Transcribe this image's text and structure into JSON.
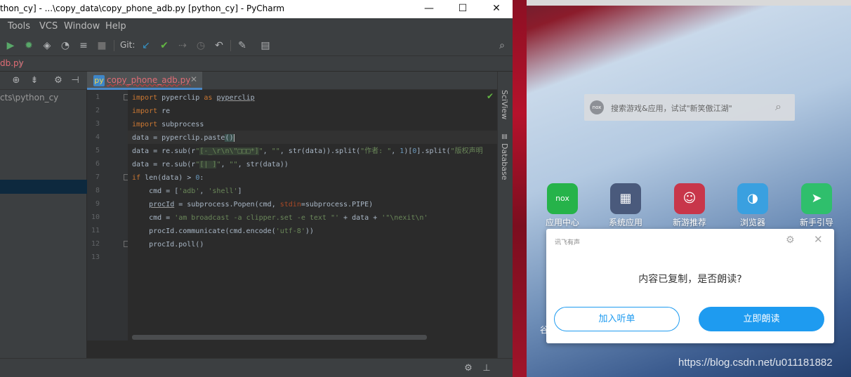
{
  "pycharm": {
    "title": "thon_cy] - ...\\copy_data\\copy_phone_adb.py [python_cy] - PyCharm",
    "window_controls": {
      "minimize": "—",
      "maximize": "☐",
      "close": "✕"
    },
    "menu": [
      "Tools",
      "VCS",
      "Window",
      "Help"
    ],
    "toolbar": {
      "git_label": "Git:"
    },
    "breadcrumb": "db.py",
    "project_panel": {
      "root_label": "cts\\python_cy"
    },
    "editor_tab": {
      "label": "copy_phone_adb.py",
      "close": "✕"
    },
    "side_tabs": [
      "SciView",
      "Database"
    ],
    "line_numbers": [
      "1",
      "2",
      "3",
      "4",
      "5",
      "6",
      "7",
      "8",
      "9",
      "10",
      "11",
      "12",
      "13"
    ],
    "code_lines": [
      "import pyperclip as pyperclip",
      "import re",
      "import subprocess",
      "data = pyperclip.paste()",
      "data = re.sub(r\"[-_\\r\\n\\\"□□□*]\", \"\", str(data)).split(\"作者: \", 1)[0].split(\"版权声明",
      "data = re.sub(r\"[| ]\", \"\", str(data))",
      "if len(data) > 0:",
      "    cmd = ['adb', 'shell']",
      "    procId = subprocess.Popen(cmd, stdin=subprocess.PIPE)",
      "    cmd = 'am broadcast -a clipper.set -e text \"' + data + '\"\\nexit\\n'",
      "    procId.communicate(cmd.encode('utf-8'))",
      "    procId.poll()",
      ""
    ]
  },
  "emulator": {
    "search_logo": "nox",
    "search_placeholder": "搜索游戏&应用，试试\"新笑傲江湖\"",
    "apps": [
      {
        "label": "应用中心",
        "color": "#26b34a",
        "glyph": "nox"
      },
      {
        "label": "系统应用",
        "color": "#4a5a7c",
        "glyph": "▦"
      },
      {
        "label": "新游推荐",
        "color": "#c8364a",
        "glyph": "☺"
      },
      {
        "label": "浏览器",
        "color": "#3aa0e0",
        "glyph": "◑"
      },
      {
        "label": "新手引导",
        "color": "#2fbf6c",
        "glyph": "➤"
      }
    ],
    "partial_label": "谷",
    "dialog": {
      "app_name": "讯飞有声",
      "message": "内容已复制，是否朗读?",
      "secondary_button": "加入听单",
      "primary_button": "立即朗读"
    }
  },
  "watermark": "https://blog.csdn.net/u011181882",
  "colors": {
    "ide_background": "#2b2b2b",
    "ide_panel": "#3c3f41",
    "keyword": "#cc7832",
    "string": "#6a8759",
    "accent_blue": "#1e9bf0"
  }
}
